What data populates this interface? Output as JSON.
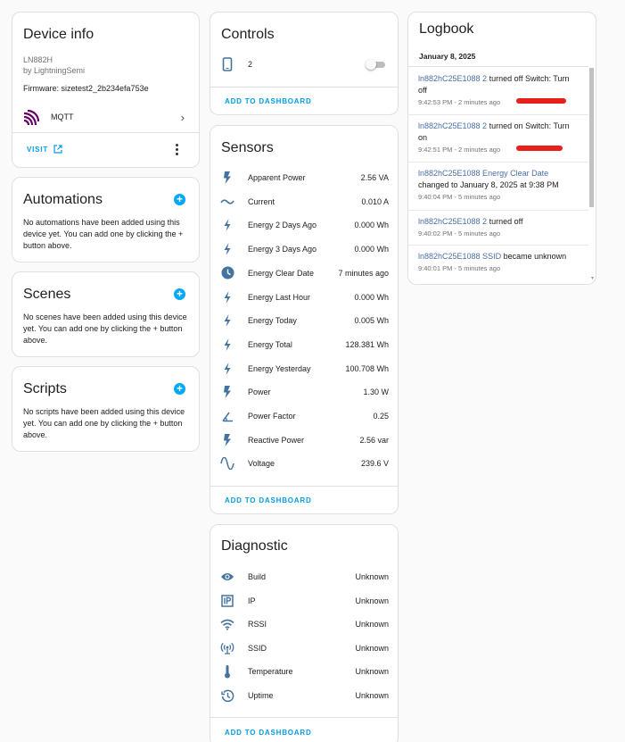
{
  "device_info": {
    "title": "Device info",
    "model": "LN882H",
    "manufacturer": "by LightningSemi",
    "firmware": "Firmware: sizetest2_2b234efa753e",
    "integration": "MQTT",
    "visit_label": "VISIT"
  },
  "automations": {
    "title": "Automations",
    "empty_text": "No automations have been added using this device yet. You can add one by clicking the + button above."
  },
  "scenes": {
    "title": "Scenes",
    "empty_text": "No scenes have been added using this device yet. You can add one by clicking the + button above."
  },
  "scripts": {
    "title": "Scripts",
    "empty_text": "No scripts have been added using this device yet. You can add one by clicking the + button above."
  },
  "controls": {
    "title": "Controls",
    "switch_name": "2",
    "switch_on": false,
    "add_label": "ADD TO DASHBOARD"
  },
  "sensors": {
    "title": "Sensors",
    "add_label": "ADD TO DASHBOARD",
    "items": [
      {
        "name": "Apparent Power",
        "value": "2.56 VA",
        "icon": "flash-icon"
      },
      {
        "name": "Current",
        "value": "0.010 A",
        "icon": "current-ac-icon"
      },
      {
        "name": "Energy 2 Days Ago",
        "value": "0.000 Wh",
        "icon": "lightning-icon"
      },
      {
        "name": "Energy 3 Days Ago",
        "value": "0.000 Wh",
        "icon": "lightning-icon"
      },
      {
        "name": "Energy Clear Date",
        "value": "7 minutes ago",
        "icon": "clock-icon"
      },
      {
        "name": "Energy Last Hour",
        "value": "0.000 Wh",
        "icon": "lightning-icon"
      },
      {
        "name": "Energy Today",
        "value": "0.005 Wh",
        "icon": "lightning-icon"
      },
      {
        "name": "Energy Total",
        "value": "128.381 Wh",
        "icon": "lightning-icon"
      },
      {
        "name": "Energy Yesterday",
        "value": "100.708 Wh",
        "icon": "lightning-icon"
      },
      {
        "name": "Power",
        "value": "1.30 W",
        "icon": "flash-icon"
      },
      {
        "name": "Power Factor",
        "value": "0.25",
        "icon": "angle-icon"
      },
      {
        "name": "Reactive Power",
        "value": "2.56 var",
        "icon": "flash-icon"
      },
      {
        "name": "Voltage",
        "value": "239.6 V",
        "icon": "sine-wave-icon"
      }
    ]
  },
  "diagnostic": {
    "title": "Diagnostic",
    "add_label": "ADD TO DASHBOARD",
    "items": [
      {
        "name": "Build",
        "value": "Unknown",
        "icon": "eye-icon"
      },
      {
        "name": "IP",
        "value": "Unknown",
        "icon": "ip-icon"
      },
      {
        "name": "RSSI",
        "value": "Unknown",
        "icon": "wifi-icon"
      },
      {
        "name": "SSID",
        "value": "Unknown",
        "icon": "access-point-icon"
      },
      {
        "name": "Temperature",
        "value": "Unknown",
        "icon": "thermometer-icon"
      },
      {
        "name": "Uptime",
        "value": "Unknown",
        "icon": "clock-outline-icon"
      }
    ]
  },
  "logbook": {
    "title": "Logbook",
    "date": "January 8, 2025",
    "entries": [
      {
        "entity": "ln882hC25E1088 2",
        "text": " turned off Switch: Turn off",
        "time": "9:42:53 PM - 2 minutes ago"
      },
      {
        "entity": "ln882hC25E1088 2",
        "text": " turned on Switch: Turn on",
        "time": "9:42:51 PM - 2 minutes ago"
      },
      {
        "entity": "ln882hC25E1088 Energy Clear Date",
        "text": " changed to January 8, 2025 at 9:38 PM",
        "time": "9:40:04 PM - 5 minutes ago"
      },
      {
        "entity": "ln882hC25E1088 2",
        "text": " turned off",
        "time": "9:40:02 PM - 5 minutes ago"
      },
      {
        "entity": "ln882hC25E1088 SSID",
        "text": " became unknown",
        "time": "9:40:01 PM - 5 minutes ago"
      }
    ]
  },
  "colors": {
    "accent": "#03a9f4",
    "icon": "#44739e",
    "mqtt": "#660066",
    "redaction": "#e8201b"
  }
}
